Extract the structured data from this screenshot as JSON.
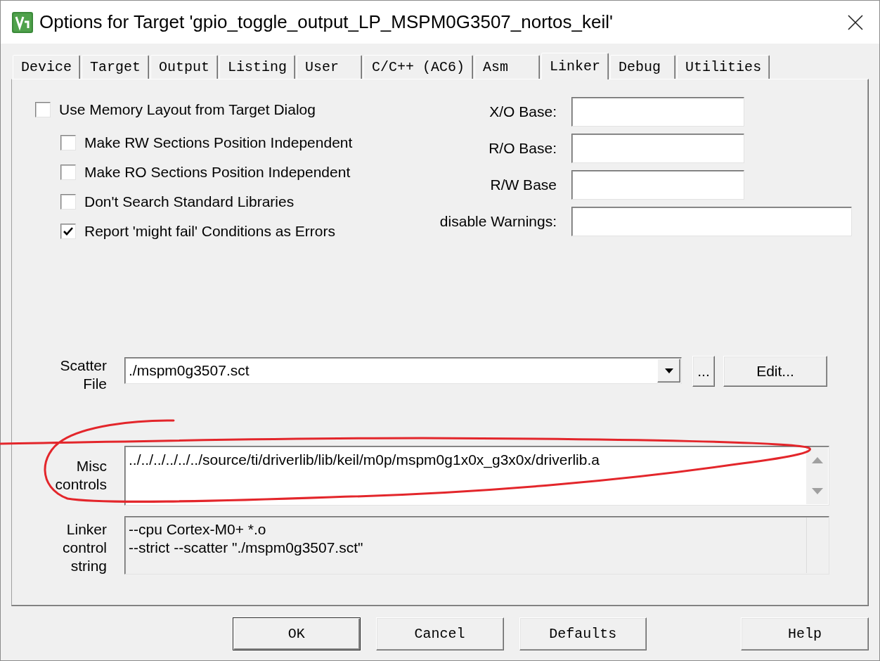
{
  "window": {
    "title": "Options for Target 'gpio_toggle_output_LP_MSPM0G3507_nortos_keil'"
  },
  "tabs": [
    {
      "label": "Device",
      "selected": false
    },
    {
      "label": "Target",
      "selected": false
    },
    {
      "label": "Output",
      "selected": false
    },
    {
      "label": "Listing",
      "selected": false
    },
    {
      "label": "User",
      "selected": false
    },
    {
      "label": "C/C++ (AC6)",
      "selected": false
    },
    {
      "label": "Asm",
      "selected": false
    },
    {
      "label": "Linker",
      "selected": true
    },
    {
      "label": "Debug",
      "selected": false
    },
    {
      "label": "Utilities",
      "selected": false
    }
  ],
  "options": [
    {
      "label": "Use Memory Layout from Target Dialog",
      "checked": false,
      "children": [
        {
          "label": "Make RW Sections Position Independent",
          "checked": false
        },
        {
          "label": "Make RO Sections Position Independent",
          "checked": false
        },
        {
          "label": "Don't Search Standard Libraries",
          "checked": false
        },
        {
          "label": "Report 'might fail' Conditions as Errors",
          "checked": true
        }
      ]
    }
  ],
  "base_fields": [
    {
      "label": "X/O Base:"
    },
    {
      "label": "R/O Base:"
    },
    {
      "label": "R/W Base"
    }
  ],
  "warnings_field": {
    "label": "disable Warnings:"
  },
  "scatter_file": {
    "label": "Scatter File",
    "value": "./mspm0g3507.sct",
    "browse_button": "...",
    "edit_button": "Edit..."
  },
  "misc_controls": {
    "label": "Misc controls",
    "value": "../../../../../../source/ti/driverlib/lib/keil/m0p/mspm0g1x0x_g3x0x/driverlib.a"
  },
  "linker_control_string": {
    "label": "Linker control string",
    "lines": [
      "--cpu Cortex-M0+ *.o",
      "--strict --scatter \"./mspm0g3507.sct\""
    ]
  },
  "buttons": [
    {
      "label": "OK",
      "default": true
    },
    {
      "label": "Cancel",
      "default": false
    },
    {
      "label": "Defaults",
      "default": false
    },
    {
      "label": "Help",
      "default": false
    }
  ]
}
